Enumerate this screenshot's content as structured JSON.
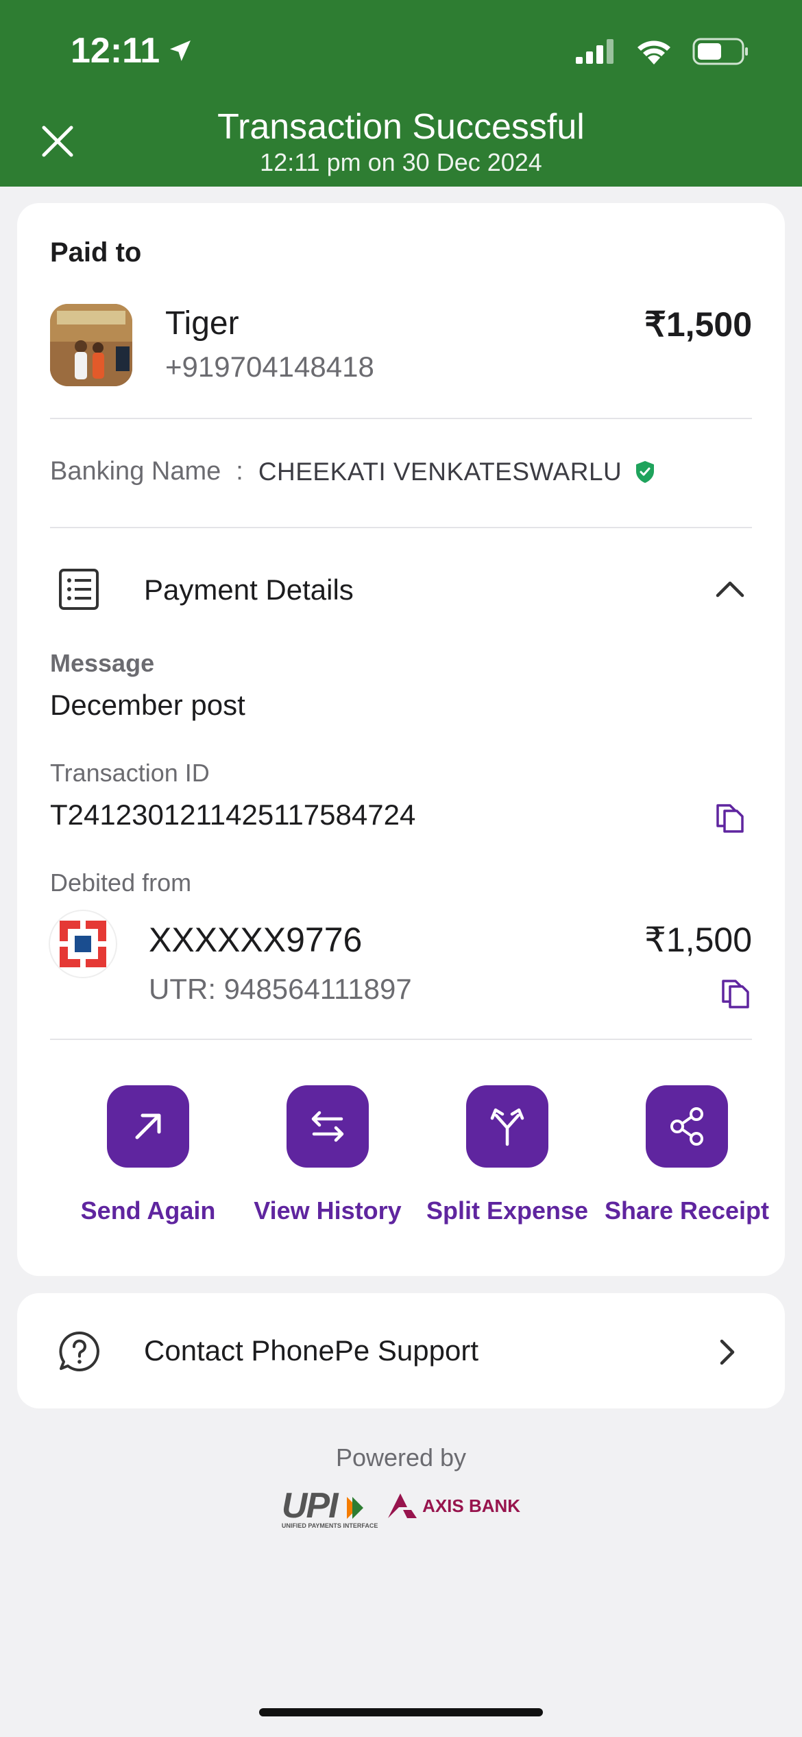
{
  "status_bar": {
    "time": "12:11"
  },
  "header": {
    "title": "Transaction Successful",
    "subtitle": "12:11 pm on 30 Dec 2024"
  },
  "payee": {
    "section_label": "Paid to",
    "name": "Tiger",
    "phone": "+919704148418",
    "amount": "₹1,500"
  },
  "banking": {
    "label": "Banking Name",
    "separator": ":",
    "name": "CHEEKATI VENKATESWARLU"
  },
  "payment_details": {
    "title": "Payment Details",
    "message_label": "Message",
    "message_value": "December post",
    "txn_label": "Transaction ID",
    "txn_value": "T2412301211425117584724",
    "debited_label": "Debited from",
    "account": "XXXXXX9776",
    "utr": "UTR: 948564111897",
    "debited_amount": "₹1,500"
  },
  "actions": [
    {
      "label": "Send Again"
    },
    {
      "label": "View History"
    },
    {
      "label": "Split Expense"
    },
    {
      "label": "Share Receipt"
    }
  ],
  "support": {
    "label": "Contact PhonePe Support"
  },
  "footer": {
    "powered_by": "Powered by",
    "upi_logo_text": "UPI",
    "upi_tagline": "UNIFIED PAYMENTS INTERFACE",
    "bank_logo_text": "AXIS BANK"
  },
  "colors": {
    "header_green": "#2e7d32",
    "accent_purple": "#5f259f",
    "verified_green": "#1fa35c"
  }
}
